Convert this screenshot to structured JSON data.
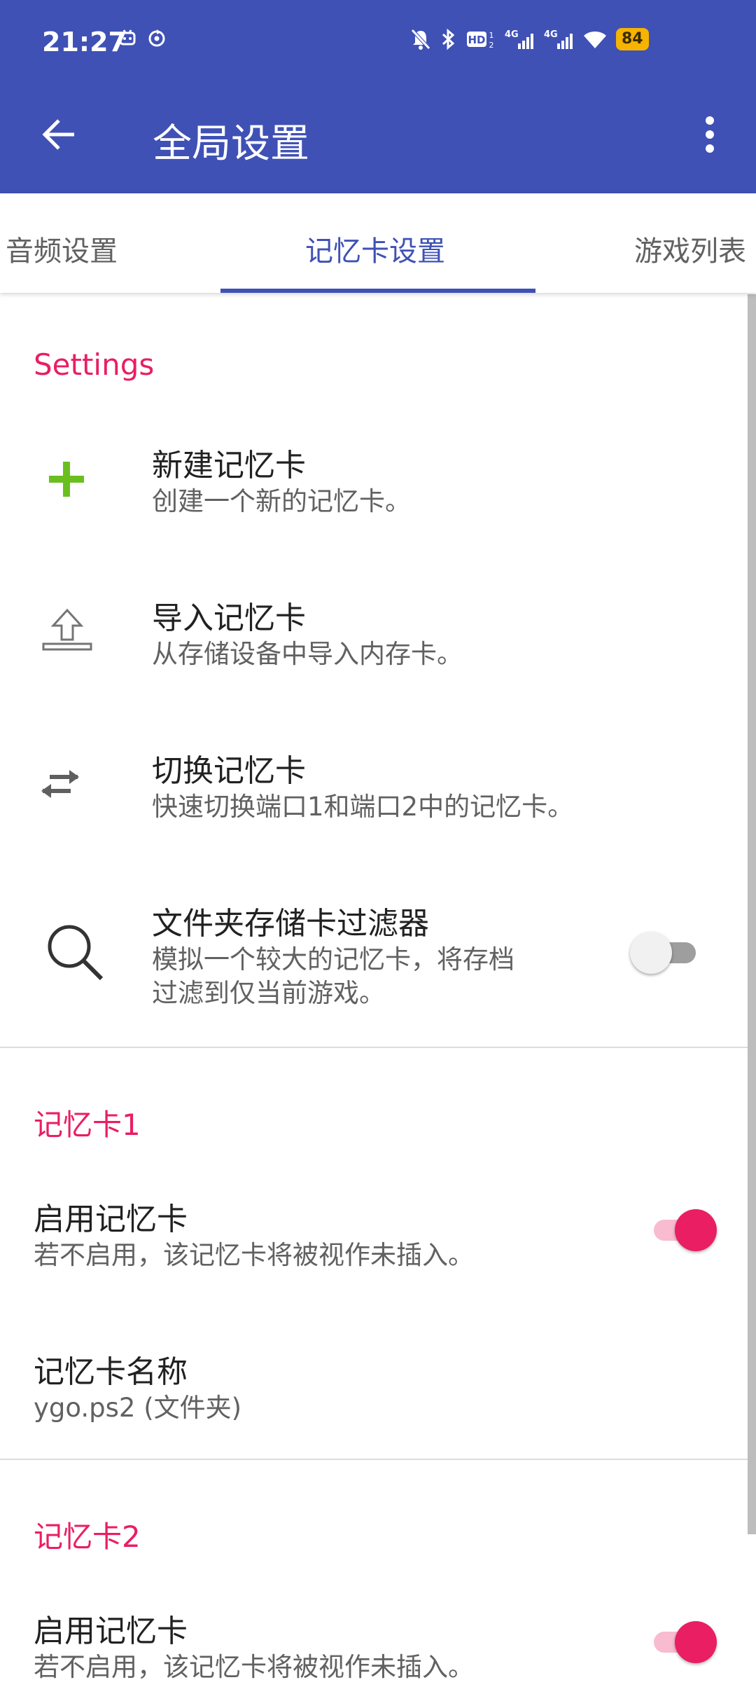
{
  "status_bar": {
    "time": "21:27",
    "battery": "84",
    "icons": [
      "notification-icon",
      "sync-icon",
      "mute-icon",
      "bluetooth-icon",
      "hd-icon",
      "signal-4g-icon",
      "signal-4g-icon",
      "wifi-icon",
      "battery-icon"
    ]
  },
  "app_bar": {
    "title": "全局设置",
    "back_icon": "arrow-left-icon",
    "menu_icon": "more-vert-icon"
  },
  "tabs": [
    {
      "label": "音频设置",
      "active": false
    },
    {
      "label": "记忆卡设置",
      "active": true
    },
    {
      "label": "游戏列表",
      "active": false
    }
  ],
  "sections": {
    "settings": {
      "header": "Settings",
      "items": [
        {
          "title": "新建记忆卡",
          "subtitle": "创建一个新的记忆卡。",
          "icon": "plus-icon"
        },
        {
          "title": "导入记忆卡",
          "subtitle": "从存储设备中导入内存卡。",
          "icon": "upload-icon"
        },
        {
          "title": "切换记忆卡",
          "subtitle": "快速切换端口1和端口2中的记忆卡。",
          "icon": "swap-icon"
        },
        {
          "title": "文件夹存储卡过滤器",
          "subtitle_line1": "模拟一个较大的记忆卡，将存档",
          "subtitle_line2": "过滤到仅当前游戏。",
          "icon": "search-icon",
          "switch_on": false
        }
      ]
    },
    "card1": {
      "header": "记忆卡1",
      "enable": {
        "title": "启用记忆卡",
        "subtitle": "若不启用，该记忆卡将被视作未插入。",
        "switch_on": true
      },
      "name": {
        "title": "记忆卡名称",
        "value": "ygo.ps2 (文件夹)"
      }
    },
    "card2": {
      "header": "记忆卡2",
      "enable": {
        "title": "启用记忆卡",
        "subtitle": "若不启用，该记忆卡将被视作未插入。",
        "switch_on": true
      }
    }
  },
  "colors": {
    "primary": "#3f51b5",
    "accent": "#e91e63",
    "plus_icon": "#6abf1e"
  }
}
